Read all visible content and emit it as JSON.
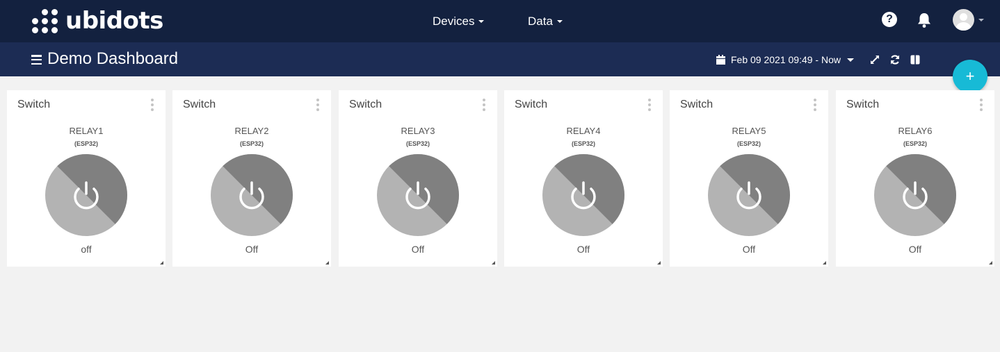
{
  "brand": {
    "name": "ubidots"
  },
  "nav": {
    "devices_label": "Devices",
    "data_label": "Data"
  },
  "header_icons": [
    "question-icon",
    "bell-icon",
    "avatar"
  ],
  "dashboard": {
    "title": "Demo Dashboard",
    "date_range": "Feb 09 2021 09:49 - Now",
    "toolbar_icons": [
      "expand-icon",
      "refresh-icon",
      "columns-icon"
    ],
    "fab_label": "+"
  },
  "colors": {
    "topbar": "#13213f",
    "subbar": "#1c2c54",
    "fab": "#17bad6",
    "switch_light": "#b3b3b3",
    "switch_dark": "#808080"
  },
  "widgets": [
    {
      "title": "Switch",
      "variable": "RELAY1",
      "device": "(ESP32)",
      "state": "off"
    },
    {
      "title": "Switch",
      "variable": "RELAY2",
      "device": "(ESP32)",
      "state": "Off"
    },
    {
      "title": "Switch",
      "variable": "RELAY3",
      "device": "(ESP32)",
      "state": "Off"
    },
    {
      "title": "Switch",
      "variable": "RELAY4",
      "device": "(ESP32)",
      "state": "Off"
    },
    {
      "title": "Switch",
      "variable": "RELAY5",
      "device": "(ESP32)",
      "state": "Off"
    },
    {
      "title": "Switch",
      "variable": "RELAY6",
      "device": "(ESP32)",
      "state": "Off"
    }
  ]
}
